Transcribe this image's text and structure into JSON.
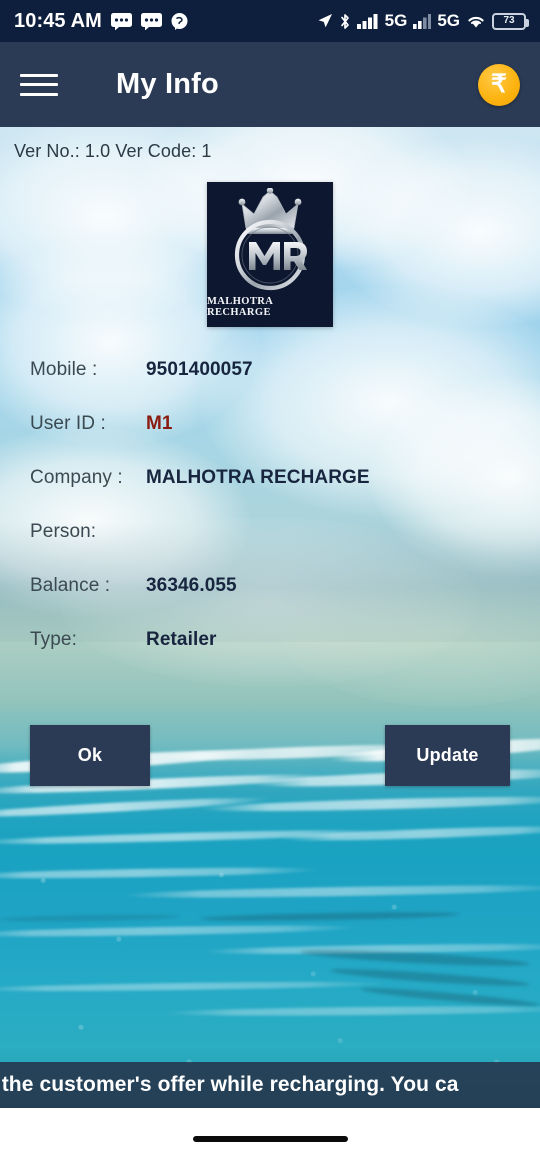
{
  "status_bar": {
    "time": "10:45 AM",
    "left_icons": [
      "message-icon",
      "message-icon",
      "chat-bubble-icon"
    ],
    "right_icons": [
      "location-arrow-icon",
      "bluetooth-icon",
      "signal-bars-icon",
      "bluetooth-icon"
    ],
    "network_label_1": "5G",
    "network_label_2": "5G",
    "battery_level": "73",
    "background_color": "#0d1f3c"
  },
  "app_bar": {
    "menu_icon": "hamburger-menu-icon",
    "title": "My Info",
    "wallet_symbol": "₹",
    "background_color": "#2b3a55",
    "badge_color": "#fcb412"
  },
  "page": {
    "version_text": "Ver No.: 1.0 Ver Code: 1"
  },
  "logo": {
    "brand_text": "MALHOTRA RECHARGE",
    "monogram": "MR",
    "background_color": "#0d1830"
  },
  "info_fields": [
    {
      "label": "Mobile :",
      "value": "9501400057",
      "style": "normal"
    },
    {
      "label": "User ID :",
      "value": "M1",
      "style": "accent"
    },
    {
      "label": "Company :",
      "value": "MALHOTRA RECHARGE",
      "style": "normal"
    },
    {
      "label": "Person:",
      "value": "",
      "style": "normal"
    },
    {
      "label": "Balance :",
      "value": "36346.055",
      "style": "normal"
    },
    {
      "label": "Type:",
      "value": "Retailer",
      "style": "normal"
    }
  ],
  "buttons": {
    "ok_label": "Ok",
    "update_label": "Update",
    "color": "#2b3a55"
  },
  "ticker": {
    "text": "k the customer's offer while recharging. You ca"
  },
  "nav_bar": {
    "gesture_pill": "home-gesture-pill"
  }
}
